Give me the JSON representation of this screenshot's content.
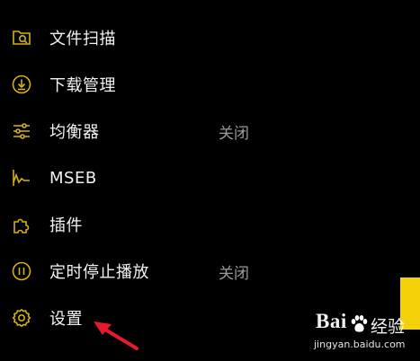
{
  "menu": {
    "items": [
      {
        "label": "文件扫描",
        "value": "",
        "icon": "folder-search-icon"
      },
      {
        "label": "下载管理",
        "value": "",
        "icon": "download-icon"
      },
      {
        "label": "均衡器",
        "value": "关闭",
        "icon": "equalizer-sliders-icon"
      },
      {
        "label": "MSEB",
        "value": "",
        "icon": "waveform-icon"
      },
      {
        "label": "插件",
        "value": "",
        "icon": "puzzle-piece-icon"
      },
      {
        "label": "定时停止播放",
        "value": "关闭",
        "icon": "timer-stop-icon"
      },
      {
        "label": "设置",
        "value": "",
        "icon": "gear-icon"
      }
    ]
  },
  "annotation": {
    "arrow_color": "#e8192c"
  },
  "watermark": {
    "brand": "Bai",
    "suffix": "经验",
    "url": "jingyan.baidu.com"
  },
  "colors": {
    "accent": "#d4b21a",
    "side_tab": "#f5d10a",
    "label": "#f2f2f2",
    "value": "#9a9a9a",
    "background": "#000000"
  }
}
